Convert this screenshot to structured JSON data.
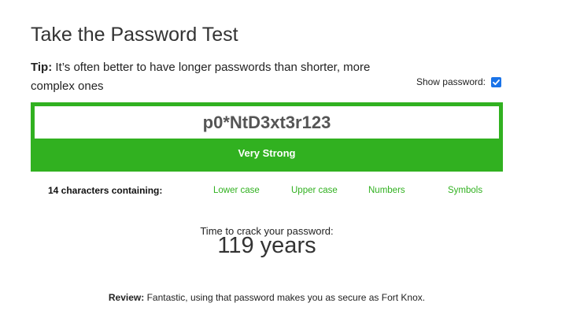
{
  "header": {
    "title": "Take the Password Test"
  },
  "tip": {
    "label": "Tip:",
    "text": "It’s often better to have longer passwords than shorter, more complex ones"
  },
  "show_password": {
    "label": "Show password:",
    "checked": true,
    "checkbox_color": "#1a73e8"
  },
  "password": {
    "value": "p0*NtD3xt3r123"
  },
  "strength": {
    "label": "Very Strong",
    "color": "#31b120"
  },
  "characters": {
    "summary": "14 characters containing:",
    "types": [
      {
        "label": "Lower case"
      },
      {
        "label": "Upper case"
      },
      {
        "label": "Numbers"
      },
      {
        "label": "Symbols"
      }
    ]
  },
  "crack": {
    "label": "Time to crack your password:",
    "value": "119 years"
  },
  "review": {
    "label": "Review:",
    "text": "Fantastic, using that password makes you as secure as Fort Knox."
  }
}
